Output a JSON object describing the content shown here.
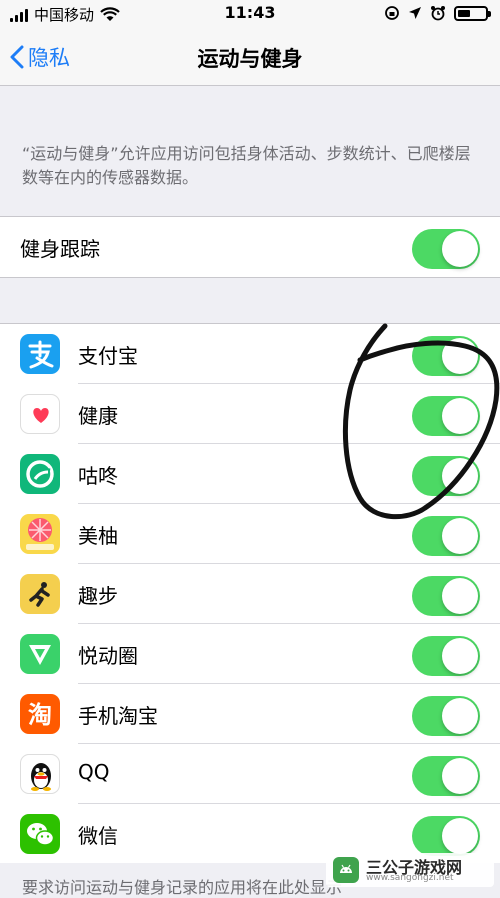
{
  "status": {
    "carrier": "中国移动",
    "time": "11:43"
  },
  "nav": {
    "back_label": "隐私",
    "title": "运动与健身"
  },
  "description": "“运动与健身”允许应用访问包括身体活动、步数统计、已爬楼层数等在内的传感器数据。",
  "fitness_tracking": {
    "label": "健身跟踪",
    "on": true
  },
  "apps": [
    {
      "name": "支付宝",
      "on": true
    },
    {
      "name": "健康",
      "on": true
    },
    {
      "name": "咕咚",
      "on": true
    },
    {
      "name": "美柚",
      "on": true
    },
    {
      "name": "趣步",
      "on": true
    },
    {
      "name": "悦动圈",
      "on": true
    },
    {
      "name": "手机淘宝",
      "on": true
    },
    {
      "name": "QQ",
      "on": true
    },
    {
      "name": "微信",
      "on": true
    }
  ],
  "footer": "要求访问运动与健身记录的应用将在此处显示",
  "watermark": {
    "text": "三公子游戏网",
    "url": "www.sangongzi.net"
  },
  "colors": {
    "accent": "#1d7df7",
    "toggle_on": "#4cd964"
  }
}
